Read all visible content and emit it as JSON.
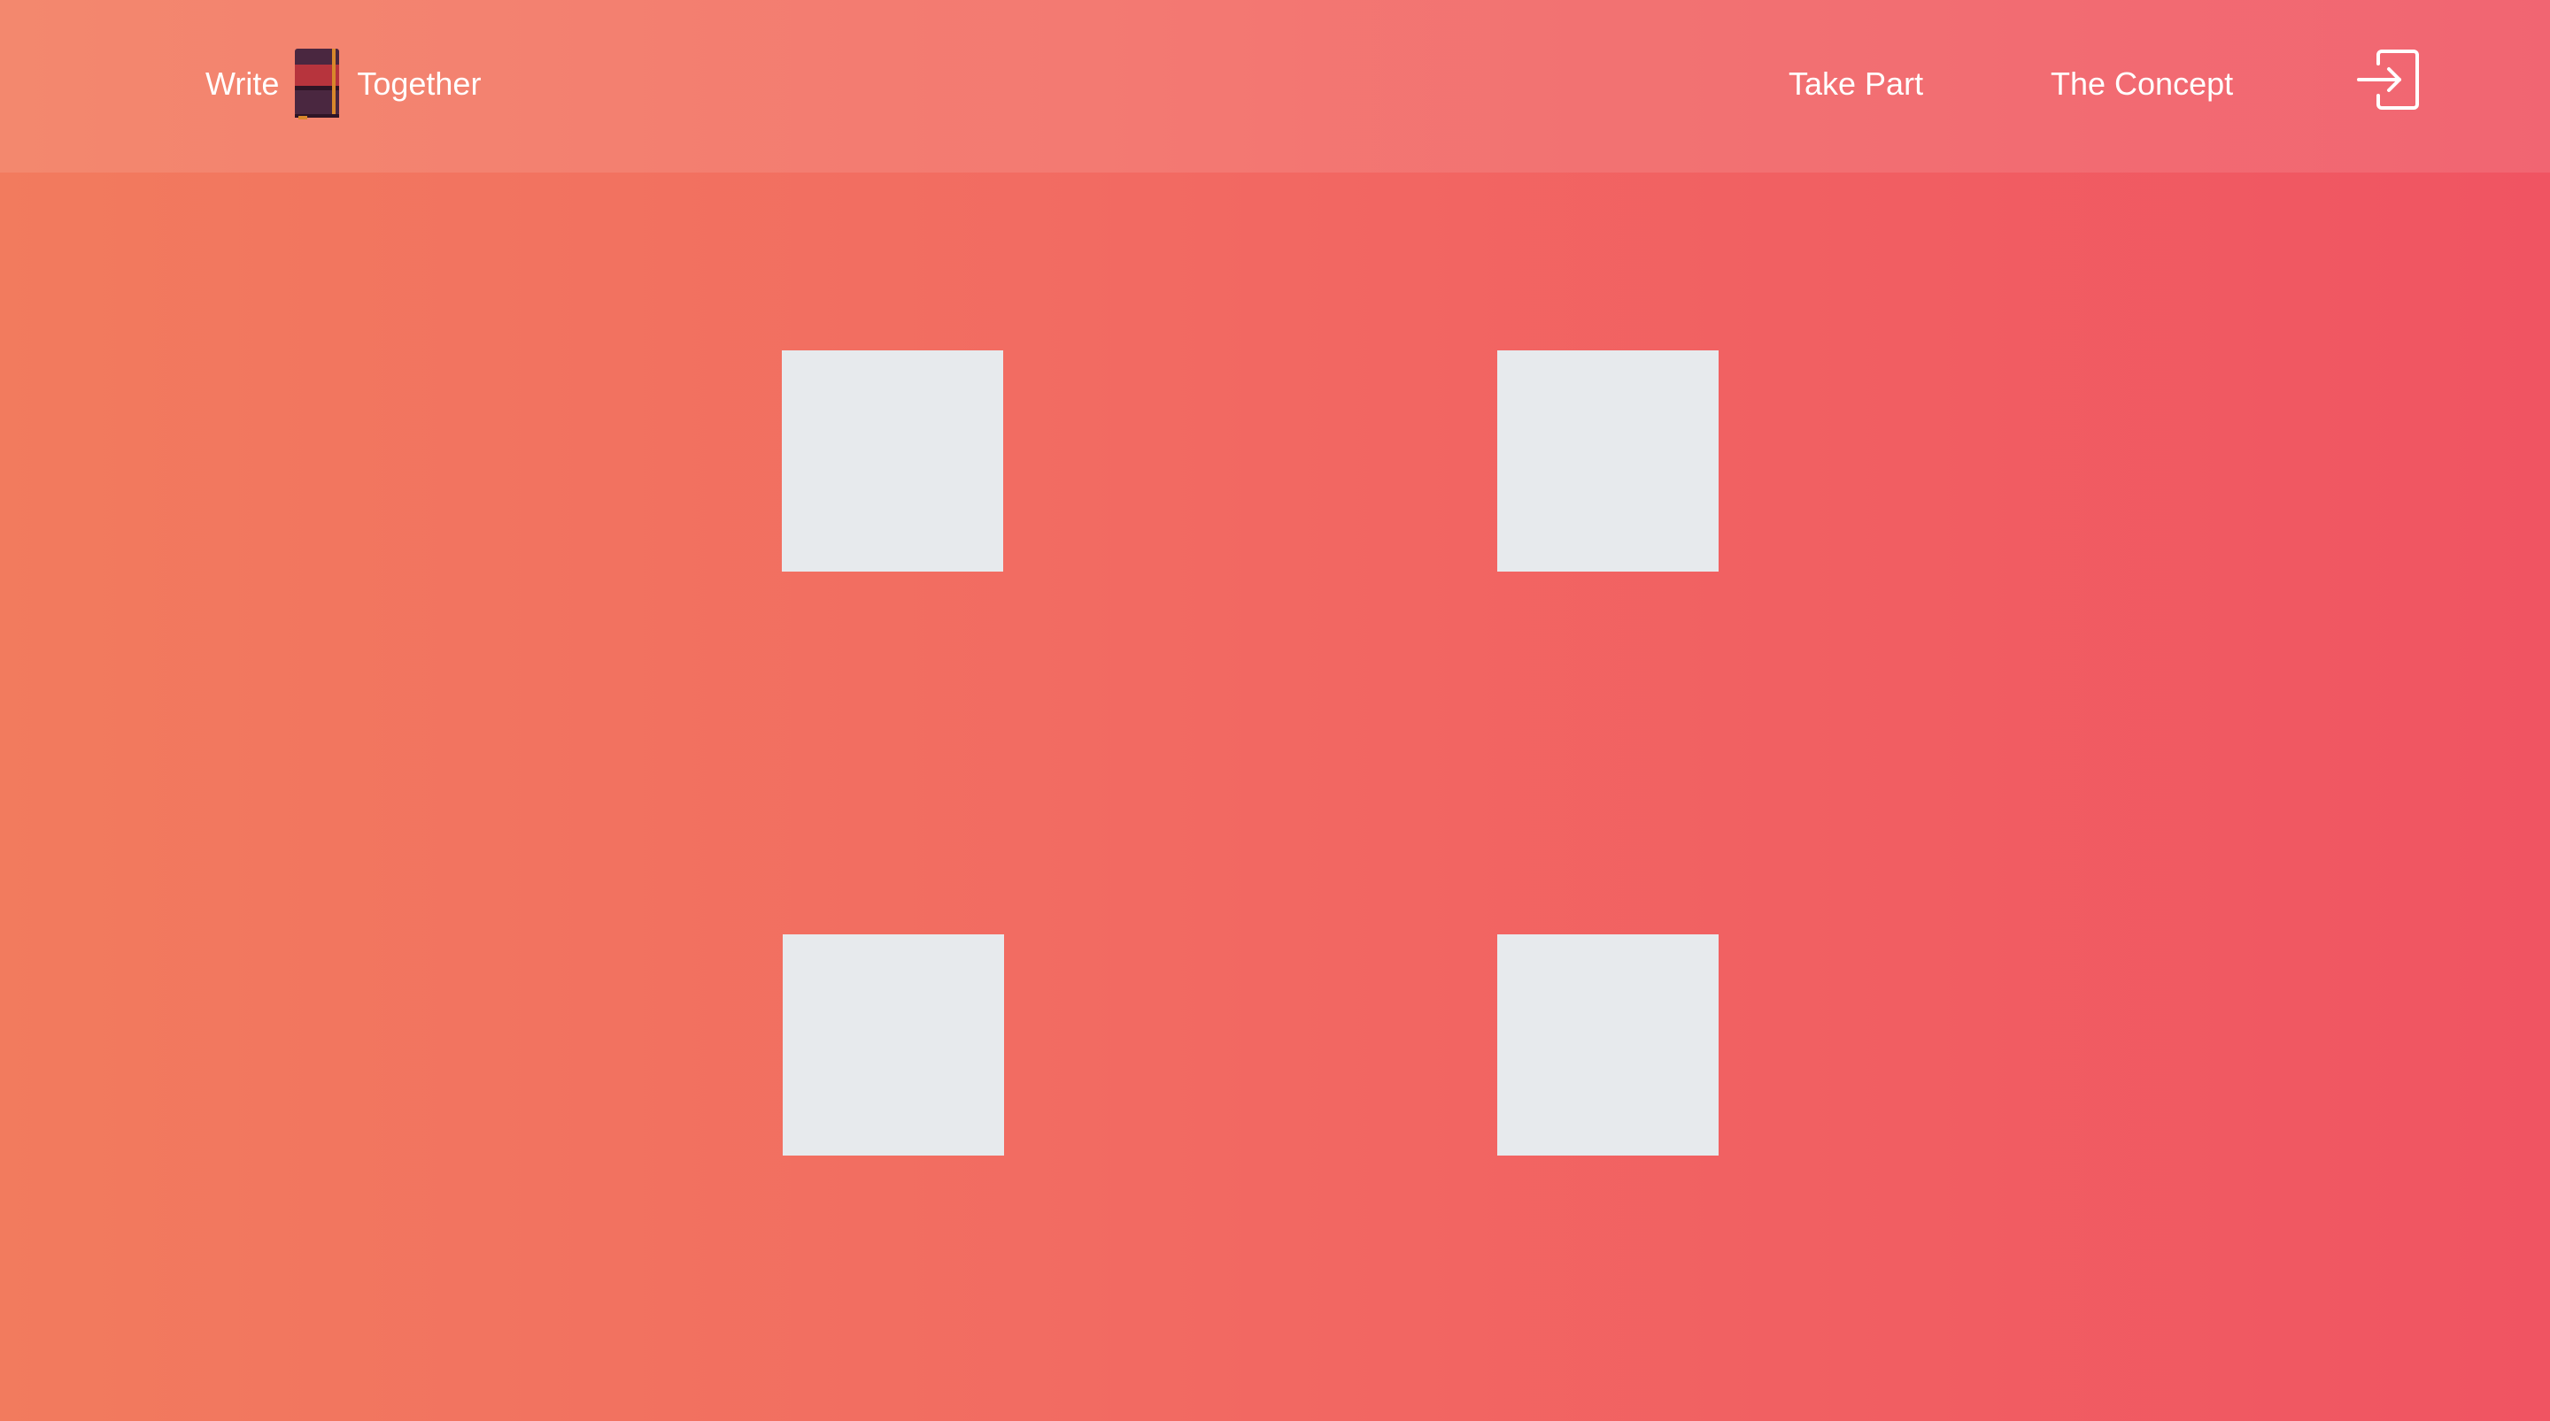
{
  "header": {
    "brand": {
      "left_word": "Write",
      "right_word": "Together",
      "icon": "notebook-icon"
    },
    "nav": {
      "take_part": "Take Part",
      "concept": "The Concept"
    },
    "login_icon": "sign-in-icon"
  },
  "colors": {
    "gradient_start": "#f27b5e",
    "gradient_end": "#f05462",
    "tile": "#e7eaed",
    "text": "#ffffff"
  },
  "tiles_count": 4
}
